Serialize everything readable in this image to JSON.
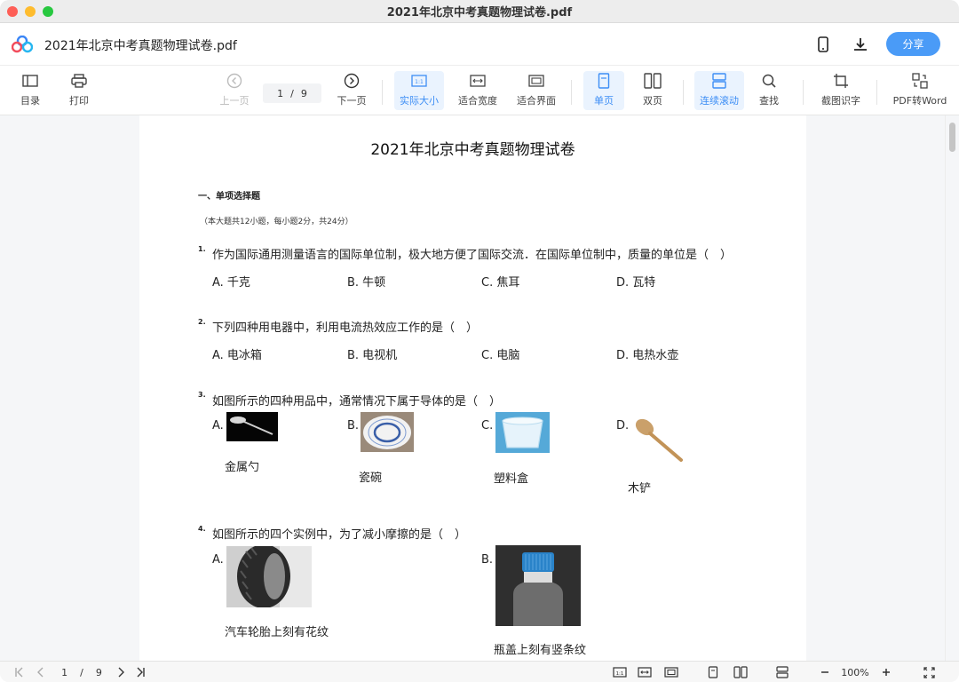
{
  "window": {
    "title": "2021年北京中考真题物理试卷.pdf"
  },
  "header": {
    "doc_name": "2021年北京中考真题物理试卷.pdf",
    "share_label": "分享"
  },
  "toolbar": {
    "toc": "目录",
    "print": "打印",
    "prev": "上一页",
    "page_current": "1",
    "page_sep": "/",
    "page_total": "9",
    "next": "下一页",
    "actual_size": "实际大小",
    "fit_width": "适合宽度",
    "fit_page": "适合界面",
    "single_page": "单页",
    "double_page": "双页",
    "continuous": "连续滚动",
    "find": "查找",
    "ocr": "截图识字",
    "to_word": "PDF转Word"
  },
  "doc": {
    "title": "2021年北京中考真题物理试卷",
    "section": "一、单项选择题",
    "note": "（本大题共12小题，每小题2分，共24分）",
    "questions": [
      {
        "num": "1.",
        "text": "作为国际通用测量语言的国际单位制，极大地方便了国际交流．在国际单位制中，质量的单位是（　）",
        "options": [
          "A. 千克",
          "B. 牛顿",
          "C. 焦耳",
          "D. 瓦特"
        ]
      },
      {
        "num": "2.",
        "text": "下列四种用电器中，利用电流热效应工作的是（　）",
        "options": [
          "A. 电冰箱",
          "B. 电视机",
          "C. 电脑",
          "D. 电热水壶"
        ]
      },
      {
        "num": "3.",
        "text": "如图所示的四种用品中，通常情况下属于导体的是（　）",
        "options": [
          "A.",
          "B.",
          "C.",
          "D."
        ],
        "captions": [
          "金属勺",
          "瓷碗",
          "塑料盒",
          "木铲"
        ]
      },
      {
        "num": "4.",
        "text": "如图所示的四个实例中，为了减小摩擦的是（　）",
        "options": [
          "A.",
          "B."
        ],
        "captions": [
          "汽车轮胎上刻有花纹",
          "瓶盖上刻有竖条纹"
        ]
      }
    ]
  },
  "statusbar": {
    "page_current": "1",
    "page_sep": "/",
    "page_total": "9",
    "zoom": "100%"
  },
  "colors": {
    "accent": "#4a9bf7",
    "active_bg": "#eaf3fe",
    "active_text": "#3d8ef5"
  }
}
